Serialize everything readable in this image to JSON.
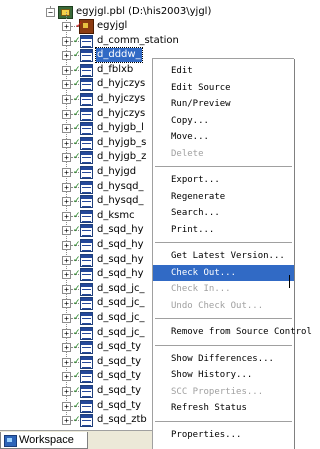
{
  "tree": {
    "library": {
      "label": "egyjgl.pbl (D:\\his2003\\yjgl)",
      "icon": "pbl-library-icon"
    },
    "rows": [
      {
        "label": "egyjgl",
        "type": "application"
      },
      {
        "label": "d_comm_station",
        "type": "datawindow"
      },
      {
        "label": "d_dddw_",
        "type": "datawindow",
        "selected": true
      },
      {
        "label": "d_fblxb",
        "type": "datawindow"
      },
      {
        "label": "d_hyjczys",
        "type": "datawindow"
      },
      {
        "label": "d_hyjczys",
        "type": "datawindow"
      },
      {
        "label": "d_hyjczys",
        "type": "datawindow"
      },
      {
        "label": "d_hyjgb_l",
        "type": "datawindow"
      },
      {
        "label": "d_hyjgb_s",
        "type": "datawindow"
      },
      {
        "label": "d_hyjgb_z",
        "type": "datawindow"
      },
      {
        "label": "d_hyjgd",
        "type": "datawindow"
      },
      {
        "label": "d_hysqd_",
        "type": "datawindow"
      },
      {
        "label": "d_hysqd_",
        "type": "datawindow"
      },
      {
        "label": "d_ksmc",
        "type": "datawindow"
      },
      {
        "label": "d_sqd_hy",
        "type": "datawindow"
      },
      {
        "label": "d_sqd_hy",
        "type": "datawindow"
      },
      {
        "label": "d_sqd_hy",
        "type": "datawindow"
      },
      {
        "label": "d_sqd_hy",
        "type": "datawindow"
      },
      {
        "label": "d_sqd_jc_",
        "type": "datawindow"
      },
      {
        "label": "d_sqd_jc_",
        "type": "datawindow"
      },
      {
        "label": "d_sqd_jc_",
        "type": "datawindow"
      },
      {
        "label": "d_sqd_jc_",
        "type": "datawindow"
      },
      {
        "label": "d_sqd_ty",
        "type": "datawindow"
      },
      {
        "label": "d_sqd_ty",
        "type": "datawindow"
      },
      {
        "label": "d_sqd_ty",
        "type": "datawindow"
      },
      {
        "label": "d_sqd_ty",
        "type": "datawindow"
      },
      {
        "label": "d_sqd_ty",
        "type": "datawindow"
      },
      {
        "label": "d_sqd_ztb",
        "type": "datawindow"
      }
    ]
  },
  "context_menu": {
    "items": [
      {
        "label": "Edit",
        "disabled": false,
        "highlighted": false
      },
      {
        "label": "Edit Source",
        "disabled": false,
        "highlighted": false
      },
      {
        "label": "Run/Preview",
        "disabled": false,
        "highlighted": false
      },
      {
        "label": "Copy...",
        "disabled": false,
        "highlighted": false
      },
      {
        "label": "Move...",
        "disabled": false,
        "highlighted": false
      },
      {
        "label": "Delete",
        "disabled": true,
        "highlighted": false
      },
      {
        "separator": true
      },
      {
        "label": "Export...",
        "disabled": false,
        "highlighted": false
      },
      {
        "label": "Regenerate",
        "disabled": false,
        "highlighted": false
      },
      {
        "label": "Search...",
        "disabled": false,
        "highlighted": false
      },
      {
        "label": "Print...",
        "disabled": false,
        "highlighted": false
      },
      {
        "separator": true
      },
      {
        "label": "Get Latest Version...",
        "disabled": false,
        "highlighted": false
      },
      {
        "label": "Check Out...",
        "disabled": false,
        "highlighted": true
      },
      {
        "label": "Check In...",
        "disabled": true,
        "highlighted": false
      },
      {
        "label": "Undo Check Out...",
        "disabled": true,
        "highlighted": false
      },
      {
        "separator": true
      },
      {
        "label": "Remove from Source Control",
        "disabled": false,
        "highlighted": false
      },
      {
        "separator": true
      },
      {
        "label": "Show Differences...",
        "disabled": false,
        "highlighted": false
      },
      {
        "label": "Show History...",
        "disabled": false,
        "highlighted": false
      },
      {
        "label": "SCC Properties...",
        "disabled": true,
        "highlighted": false
      },
      {
        "label": "Refresh Status",
        "disabled": false,
        "highlighted": false
      },
      {
        "separator": true
      },
      {
        "label": "Properties...",
        "disabled": false,
        "highlighted": false
      }
    ]
  },
  "bottom_tabs": {
    "workspace_label": "Workspace"
  },
  "colors": {
    "selection": "#316ac5",
    "disabled_text": "#a0a0a0",
    "menu_bg": "#ffffff"
  }
}
